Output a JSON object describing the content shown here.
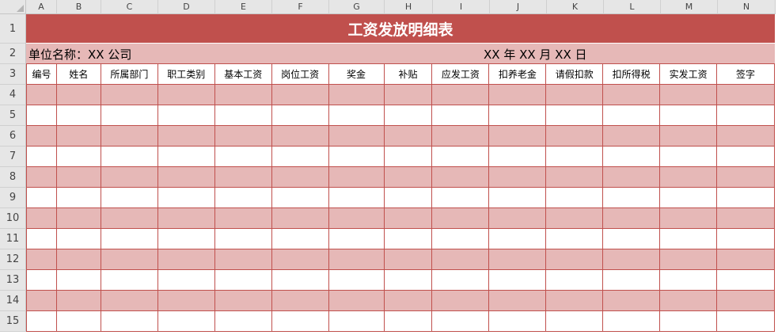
{
  "columns": [
    "A",
    "B",
    "C",
    "D",
    "E",
    "F",
    "G",
    "H",
    "I",
    "J",
    "K",
    "L",
    "M",
    "N"
  ],
  "row_numbers": [
    "1",
    "2",
    "3",
    "4",
    "5",
    "6",
    "7",
    "8",
    "9",
    "10",
    "11",
    "12",
    "13",
    "14",
    "15"
  ],
  "title": "工资发放明细表",
  "unit_label": "单位名称：XX 公司",
  "date_label": "XX 年 XX 月 XX 日",
  "headers": [
    "编号",
    "姓名",
    "所属部门",
    "职工类别",
    "基本工资",
    "岗位工资",
    "奖金",
    "补贴",
    "应发工资",
    "扣养老金",
    "请假扣款",
    "扣所得税",
    "实发工资",
    "签字"
  ],
  "colors": {
    "title_bg": "#c0504d",
    "band_bg": "#e6b8b7",
    "border": "#c0504d",
    "header_bar": "#e6e6e6"
  }
}
